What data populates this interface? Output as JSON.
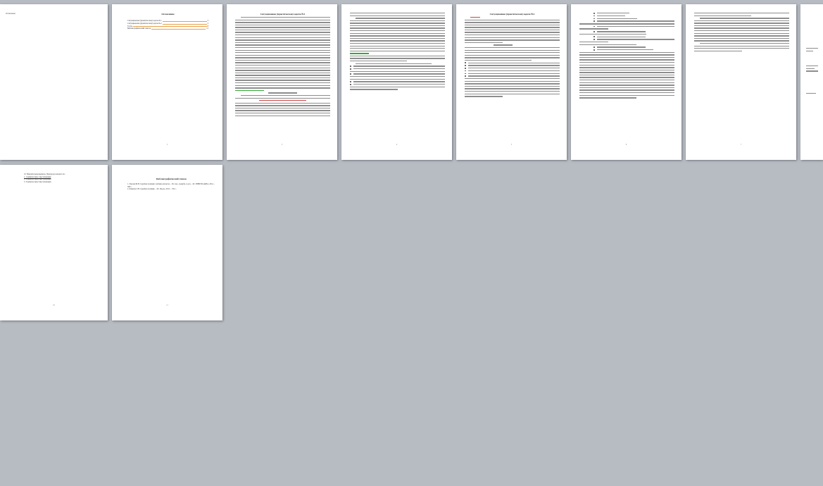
{
  "pages": [
    {
      "id": "p1",
      "heading": "Оглавление",
      "number": ""
    },
    {
      "id": "p2",
      "heading": "Оглавление",
      "number": "2",
      "toc": [
        {
          "label": "Ситуационная (практическая) задача №1",
          "page": "3"
        },
        {
          "label": "Ситуационная (практическая) задача №2",
          "page": "5"
        },
        {
          "label": "Тесты",
          "page": "8"
        },
        {
          "label": "Библиографический список",
          "page": "11"
        }
      ]
    },
    {
      "id": "p3",
      "heading": "Ситуационная (практическая) задача №1",
      "number": "3"
    },
    {
      "id": "p4",
      "heading": "",
      "number": "4"
    },
    {
      "id": "p5",
      "heading": "Ситуационная (практическая) задача №2",
      "number": "5"
    },
    {
      "id": "p6",
      "heading": "",
      "number": "6"
    },
    {
      "id": "p7",
      "heading": "",
      "number": "7"
    },
    {
      "id": "p8",
      "heading": "",
      "number": ""
    },
    {
      "id": "p9",
      "heading": "",
      "number": "10",
      "items": [
        "10. Накопительная выписка. Прокурора поможет кто",
        "1. 1 выписка прав-1 выступающим",
        "2. 2 выписка прав-2 выступающим",
        "3. 3 выписка прав-3 выступающим"
      ]
    },
    {
      "id": "p10",
      "heading": "Библиографический список",
      "number": "11",
      "refs": [
        "1.     Хмелев Ш.Н. Судебная полиция: учебник для вузов. – М.: изд., подрубр. и доп. – М.: ЮНИТИ-ДАНА, 2014. – 568 с.",
        "2.     Климова Т.Н. Судебная полиция. – М.: Изд-во, 2012. – 352 с."
      ]
    }
  ]
}
